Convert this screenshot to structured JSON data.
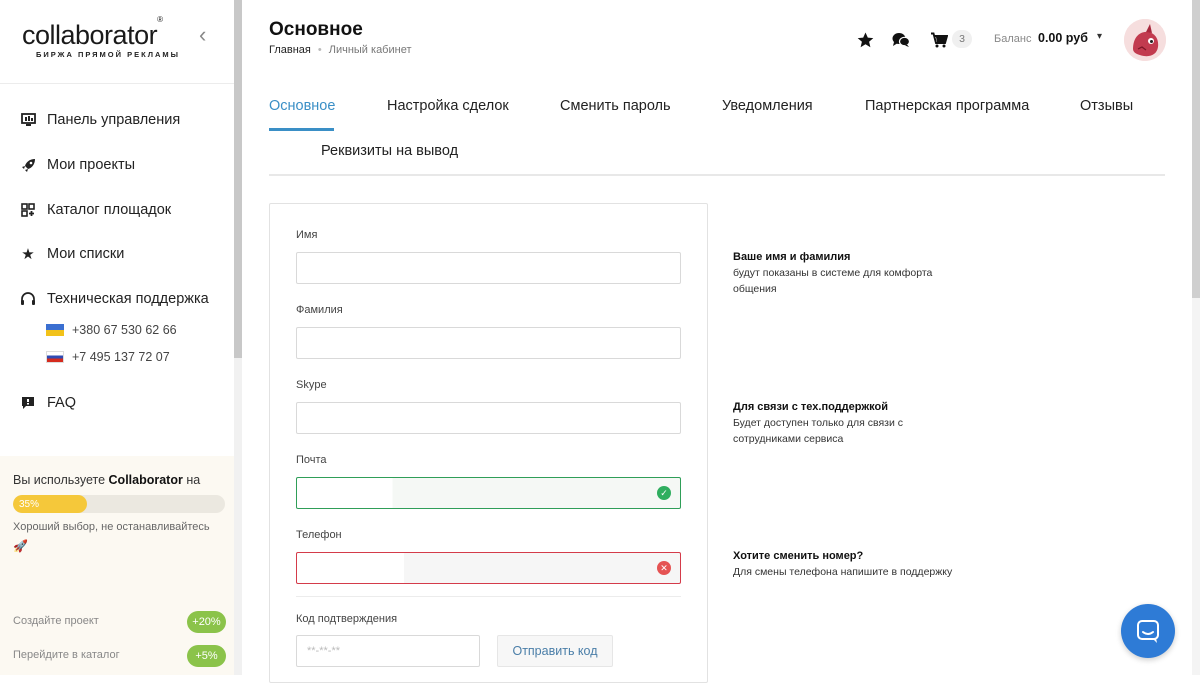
{
  "logo": {
    "text": "collaborator",
    "reg": "®",
    "subtitle": "БИРЖА ПРЯМОЙ РЕКЛАМЫ"
  },
  "sidebar": {
    "items": [
      {
        "label": "Панель управления",
        "icon": "dashboard-icon"
      },
      {
        "label": "Мои проекты",
        "icon": "rocket-icon"
      },
      {
        "label": "Каталог площадок",
        "icon": "catalog-icon"
      },
      {
        "label": "Мои списки",
        "icon": "star-icon"
      },
      {
        "label": "Техническая поддержка",
        "icon": "headset-icon"
      },
      {
        "label": "FAQ",
        "icon": "chat-faq-icon"
      }
    ],
    "phones": [
      {
        "flag": "ua",
        "number": "+380 67 530 62 66"
      },
      {
        "flag": "ru",
        "number": "+7 495 137 72 07"
      }
    ],
    "promo": {
      "prefix": "Вы используете ",
      "brand": "Collaborator",
      "suffix": " на",
      "progress": 35,
      "progress_label": "35%",
      "note": "Хороший выбор, не останавливайтесь",
      "tasks": [
        {
          "label": "Создайте проект",
          "badge": "+20%"
        },
        {
          "label": "Перейдите в каталог",
          "badge": "+5%"
        }
      ]
    }
  },
  "header": {
    "title": "Основное",
    "breadcrumb": [
      "Главная",
      "Личный кабинет"
    ],
    "cart_count": "3",
    "balance_label": "Баланс",
    "balance_value": "0.00 руб"
  },
  "tabs": [
    {
      "label": "Основное",
      "active": true
    },
    {
      "label": "Настройка сделок",
      "active": false
    },
    {
      "label": "Сменить пароль",
      "active": false
    },
    {
      "label": "Уведомления",
      "active": false
    },
    {
      "label": "Партнерская программа",
      "active": false
    },
    {
      "label": "Отзывы",
      "active": false
    },
    {
      "label": "Реквизиты на вывод",
      "active": false
    }
  ],
  "form": {
    "fields": [
      {
        "label": "Имя",
        "value": "",
        "state": "default"
      },
      {
        "label": "Фамилия",
        "value": "",
        "state": "default"
      },
      {
        "label": "Skype",
        "value": "",
        "state": "default"
      },
      {
        "label": "Почта",
        "value": "",
        "state": "valid"
      },
      {
        "label": "Телефон",
        "value": "",
        "state": "invalid"
      }
    ],
    "code_label": "Код подтверждения",
    "code_placeholder": "**-**-**",
    "send_code": "Отправить код"
  },
  "hints": [
    {
      "title": "Ваше имя и фамилия",
      "text": "будут показаны в системе для комфорта общения"
    },
    {
      "title": "Для связи с тех.поддержкой",
      "text": "Будет доступен только для связи с сотрудниками сервиса"
    },
    {
      "title": "Хотите сменить номер?",
      "text": "Для смены телефона напишите в поддержку"
    }
  ],
  "colors": {
    "accent": "#3a8fc6",
    "valid": "#2f9e58",
    "invalid": "#d43b4a",
    "promo_bar": "#f5c83a",
    "badge": "#8bc34a",
    "chat": "#2e7bd6"
  }
}
